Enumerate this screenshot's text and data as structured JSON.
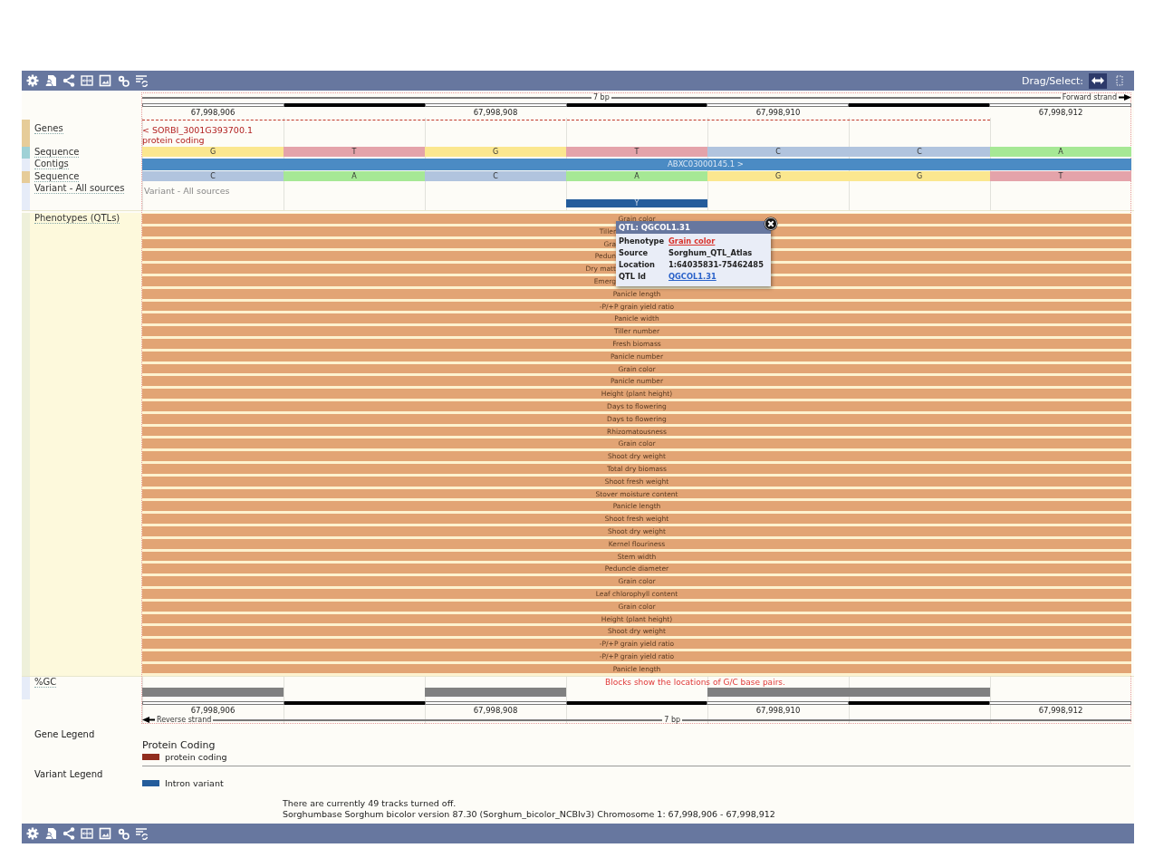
{
  "toolbar": {
    "label": "Drag/Select:",
    "modes": [
      {
        "selected": true
      },
      {
        "selected": false
      }
    ]
  },
  "ruler_top": {
    "scale": "7 bp",
    "strand": "Forward strand",
    "positions": [
      "67,998,906",
      "67,998,908",
      "67,998,910",
      "67,998,912"
    ]
  },
  "genes": {
    "label": "Genes",
    "color": "#e6cc99",
    "gene": "< SORBI_3001G393700.1",
    "biotype": "protein coding"
  },
  "sequence_forward": {
    "label": "Sequence",
    "color": "#9fd1d6",
    "bases": [
      {
        "base": "G",
        "color": "#fbe78f"
      },
      {
        "base": "T",
        "color": "#e4a3aa"
      },
      {
        "base": "G",
        "color": "#fbe78f"
      },
      {
        "base": "T",
        "color": "#e4a3aa"
      },
      {
        "base": "C",
        "color": "#b1c4de"
      },
      {
        "base": "C",
        "color": "#b1c4de"
      },
      {
        "base": "A",
        "color": "#a6e895"
      }
    ]
  },
  "contigs": {
    "label": "Contigs",
    "color": "#e6ecf8",
    "name": "ABXC03000145.1 >"
  },
  "sequence_reverse": {
    "label": "Sequence",
    "color": "#e6cc99",
    "bases": [
      {
        "base": "C",
        "color": "#b1c4de"
      },
      {
        "base": "A",
        "color": "#a6e895"
      },
      {
        "base": "C",
        "color": "#b1c4de"
      },
      {
        "base": "A",
        "color": "#a6e895"
      },
      {
        "base": "G",
        "color": "#fbe78f"
      },
      {
        "base": "G",
        "color": "#fbe78f"
      },
      {
        "base": "T",
        "color": "#e4a3aa"
      }
    ]
  },
  "variants": {
    "label": "Variant - All sources",
    "color": "#e6ecf8",
    "track_note": "Variant - All sources",
    "cells": [
      {
        "hit": false
      },
      {
        "hit": false
      },
      {
        "hit": false
      },
      {
        "hit": true,
        "allele": "Y"
      },
      {
        "hit": false
      },
      {
        "hit": false
      },
      {
        "hit": false
      }
    ]
  },
  "phenotypes": {
    "label": "Phenotypes (QTLs)",
    "color": "#eef0da",
    "qtls": [
      {
        "name": "Grain color",
        "kind": "full"
      },
      {
        "name": "Tiller",
        "kind": "cut"
      },
      {
        "name": "Gra",
        "kind": "cut"
      },
      {
        "name": "Pedun",
        "kind": "cut"
      },
      {
        "name": "Dry matt",
        "kind": "cut"
      },
      {
        "name": "Emerg",
        "kind": "cut"
      },
      {
        "name": "Panicle length",
        "kind": "full"
      },
      {
        "name": "-P/+P grain yield ratio",
        "kind": "full"
      },
      {
        "name": "Panicle width",
        "kind": "full"
      },
      {
        "name": "Tiller number",
        "kind": "full"
      },
      {
        "name": "Fresh biomass",
        "kind": "full"
      },
      {
        "name": "Panicle number",
        "kind": "full"
      },
      {
        "name": "Grain color",
        "kind": "full"
      },
      {
        "name": "Panicle number",
        "kind": "full"
      },
      {
        "name": "Height (plant height)",
        "kind": "full"
      },
      {
        "name": "Days to flowering",
        "kind": "full"
      },
      {
        "name": "Days to flowering",
        "kind": "full"
      },
      {
        "name": "Rhizomatousness",
        "kind": "full"
      },
      {
        "name": "Grain color",
        "kind": "full"
      },
      {
        "name": "Shoot dry weight",
        "kind": "full"
      },
      {
        "name": "Total dry biomass",
        "kind": "full"
      },
      {
        "name": "Shoot fresh weight",
        "kind": "full"
      },
      {
        "name": "Stover moisture content",
        "kind": "full"
      },
      {
        "name": "Panicle length",
        "kind": "full"
      },
      {
        "name": "Shoot fresh weight",
        "kind": "full"
      },
      {
        "name": "Shoot dry weight",
        "kind": "full"
      },
      {
        "name": "Kernel flouriness",
        "kind": "full"
      },
      {
        "name": "Stem width",
        "kind": "full"
      },
      {
        "name": "Peduncle diameter",
        "kind": "full"
      },
      {
        "name": "Grain color",
        "kind": "full"
      },
      {
        "name": "Leaf chlorophyll content",
        "kind": "full"
      },
      {
        "name": "Grain color",
        "kind": "full"
      },
      {
        "name": "Height (plant height)",
        "kind": "full"
      },
      {
        "name": "Shoot dry weight",
        "kind": "full"
      },
      {
        "name": "-P/+P grain yield ratio",
        "kind": "full"
      },
      {
        "name": "-P/+P grain yield ratio",
        "kind": "full"
      },
      {
        "name": "Panicle length",
        "kind": "full"
      }
    ]
  },
  "popup": {
    "title": "QTL: QGCOL1.31",
    "rows": [
      {
        "key": "Phenotype",
        "value": "Grain color",
        "kind": "red-link"
      },
      {
        "key": "Source",
        "value": "Sorghum_QTL_Atlas",
        "kind": "text"
      },
      {
        "key": "Location",
        "value": "1:64035831-75462485",
        "kind": "text"
      },
      {
        "key": "QTL Id",
        "value": "QGCOL1.31",
        "kind": "blue-link"
      }
    ]
  },
  "gc": {
    "label": "%GC",
    "color": "#e6ecf8",
    "note": "Blocks show the locations of G/C base pairs.",
    "blocks": [
      {
        "gc": true
      },
      {
        "gc": false
      },
      {
        "gc": true
      },
      {
        "gc": false
      },
      {
        "gc": true
      },
      {
        "gc": true
      },
      {
        "gc": false
      }
    ]
  },
  "ruler_bottom": {
    "scale": "7 bp",
    "strand": "Reverse strand",
    "positions": [
      "67,998,906",
      "67,998,908",
      "67,998,910",
      "67,998,912"
    ]
  },
  "legends": [
    {
      "title": "Gene Legend",
      "heading": "Protein Coding",
      "items": [
        {
          "label": "protein coding",
          "color": "#912d1e"
        }
      ]
    },
    {
      "title": "Variant Legend",
      "items": [
        {
          "label": "Intron variant",
          "color": "#245c9b"
        }
      ]
    }
  ],
  "footer": [
    "There are currently 49 tracks turned off.",
    "Sorghumbase Sorghum bicolor version 87.30 (Sorghum_bicolor_NCBIv3) Chromosome 1: 67,998,906 - 67,998,912"
  ]
}
